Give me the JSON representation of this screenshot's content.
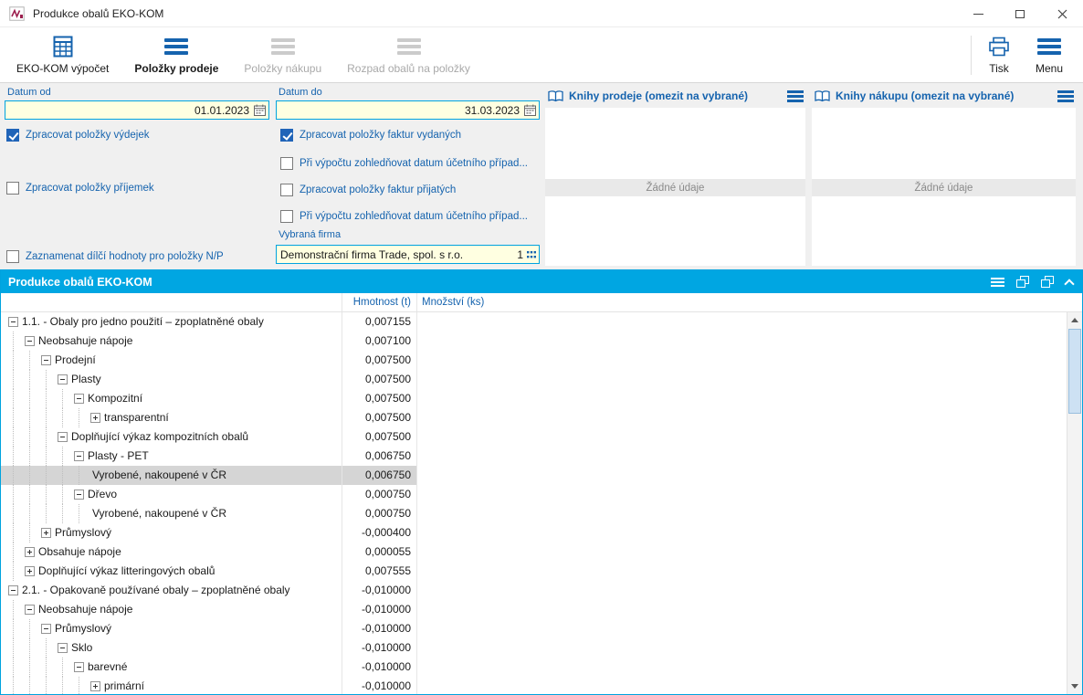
{
  "window": {
    "title": "Produkce obalů EKO-KOM"
  },
  "toolbar": {
    "buttons": [
      {
        "id": "ekokom-calculation",
        "label": "EKO-KOM výpočet",
        "icon": "calc-table-icon",
        "enabled": true,
        "active": false
      },
      {
        "id": "sale-items",
        "label": "Položky prodeje",
        "icon": "list-icon",
        "enabled": true,
        "active": true
      },
      {
        "id": "purchase-items",
        "label": "Položky nákupu",
        "icon": "list-icon",
        "enabled": false,
        "active": false
      },
      {
        "id": "package-breakdown",
        "label": "Rozpad obalů na položky",
        "icon": "list-icon",
        "enabled": false,
        "active": false
      }
    ],
    "print_label": "Tisk",
    "menu_label": "Menu"
  },
  "filters": {
    "date_from": {
      "label": "Datum od",
      "value": "01.01.2023"
    },
    "date_to": {
      "label": "Datum do",
      "value": "31.03.2023"
    },
    "checkboxes_left": [
      {
        "label": "Zpracovat položky výdejek",
        "checked": true
      },
      {
        "label": "Zpracovat položky příjemek",
        "checked": false
      },
      {
        "label": "Zaznamenat dílčí hodnoty pro položky N/P",
        "checked": false
      }
    ],
    "checkboxes_middle": [
      {
        "label": "Zpracovat položky faktur vydaných",
        "checked": true
      },
      {
        "label": "Při výpočtu zohledňovat datum účetního případ...",
        "checked": false
      },
      {
        "label": "Zpracovat položky faktur přijatých",
        "checked": false
      },
      {
        "label": "Při výpočtu zohledňovat datum účetního případ...",
        "checked": false
      }
    ],
    "company": {
      "label": "Vybraná firma",
      "value": "Demonstrační firma Trade, spol. s r.o.",
      "number": "1"
    }
  },
  "book_panels": [
    {
      "id": "sales-books",
      "title": "Knihy prodeje (omezit na vybrané)",
      "empty_text": "Žádné údaje"
    },
    {
      "id": "purchase-books",
      "title": "Knihy nákupu (omezit na vybrané)",
      "empty_text": "Žádné údaje"
    }
  ],
  "grid": {
    "title": "Produkce obalů EKO-KOM",
    "columns": [
      "Hmotnost (t)",
      "Množství (ks)"
    ],
    "rows": [
      {
        "label": "1.1. - Obaly pro jedno použití – zpoplatněné obaly",
        "level": 0,
        "expander": "minus",
        "weight": "0,007155",
        "selected": false
      },
      {
        "label": "Neobsahuje nápoje",
        "level": 1,
        "expander": "minus",
        "weight": "0,007100",
        "selected": false
      },
      {
        "label": "Prodejní",
        "level": 2,
        "expander": "minus",
        "weight": "0,007500",
        "selected": false
      },
      {
        "label": "Plasty",
        "level": 3,
        "expander": "minus",
        "weight": "0,007500",
        "selected": false
      },
      {
        "label": "Kompozitní",
        "level": 4,
        "expander": "minus",
        "weight": "0,007500",
        "selected": false
      },
      {
        "label": "transparentní",
        "level": 5,
        "expander": "plus",
        "weight": "0,007500",
        "selected": false
      },
      {
        "label": "Doplňující výkaz kompozitních obalů",
        "level": 3,
        "expander": "minus",
        "weight": "0,007500",
        "selected": false
      },
      {
        "label": "Plasty - PET",
        "level": 4,
        "expander": "minus",
        "weight": "0,006750",
        "selected": false
      },
      {
        "label": "Vyrobené, nakoupené v ČR",
        "level": 5,
        "expander": "none",
        "weight": "0,006750",
        "selected": true
      },
      {
        "label": "Dřevo",
        "level": 4,
        "expander": "minus",
        "weight": "0,000750",
        "selected": false
      },
      {
        "label": "Vyrobené, nakoupené v ČR",
        "level": 5,
        "expander": "none",
        "weight": "0,000750",
        "selected": false
      },
      {
        "label": "Průmyslový",
        "level": 2,
        "expander": "plus",
        "weight": "-0,000400",
        "selected": false
      },
      {
        "label": "Obsahuje nápoje",
        "level": 1,
        "expander": "plus",
        "weight": "0,000055",
        "selected": false
      },
      {
        "label": "Doplňující výkaz litteringových obalů",
        "level": 1,
        "expander": "plus",
        "weight": "0,007555",
        "selected": false
      },
      {
        "label": "2.1. - Opakovaně používané obaly – zpoplatněné obaly",
        "level": 0,
        "expander": "minus",
        "weight": "-0,010000",
        "selected": false
      },
      {
        "label": "Neobsahuje nápoje",
        "level": 1,
        "expander": "minus",
        "weight": "-0,010000",
        "selected": false
      },
      {
        "label": "Průmyslový",
        "level": 2,
        "expander": "minus",
        "weight": "-0,010000",
        "selected": false
      },
      {
        "label": "Sklo",
        "level": 3,
        "expander": "minus",
        "weight": "-0,010000",
        "selected": false
      },
      {
        "label": "barevné",
        "level": 4,
        "expander": "minus",
        "weight": "-0,010000",
        "selected": false
      },
      {
        "label": "primární",
        "level": 5,
        "expander": "plus",
        "weight": "-0,010000",
        "selected": false
      }
    ]
  }
}
